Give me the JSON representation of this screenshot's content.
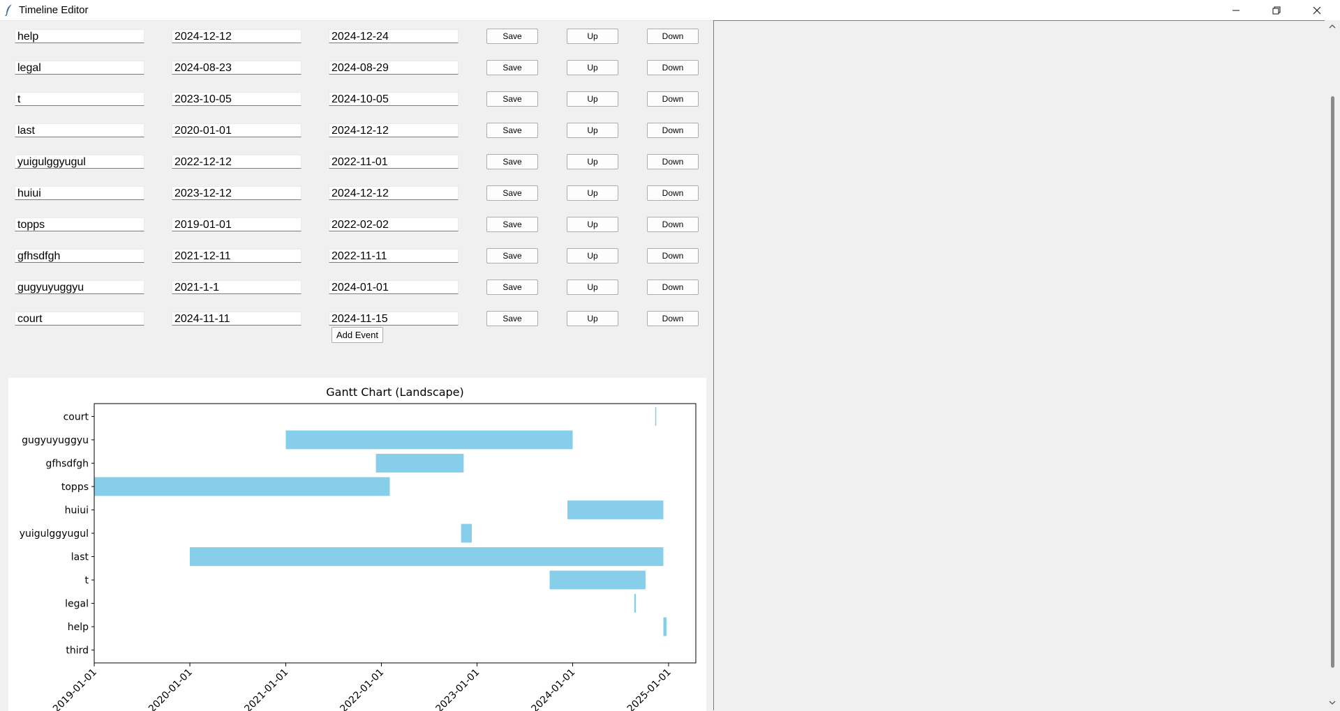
{
  "window": {
    "title": "Timeline Editor"
  },
  "events": [
    {
      "name": "help",
      "start": "2024-12-12",
      "end": "2024-12-24"
    },
    {
      "name": "legal",
      "start": "2024-08-23",
      "end": "2024-08-29"
    },
    {
      "name": "t",
      "start": "2023-10-05",
      "end": "2024-10-05"
    },
    {
      "name": "last",
      "start": "2020-01-01",
      "end": "2024-12-12"
    },
    {
      "name": "yuigulggyugul",
      "start": "2022-12-12",
      "end": "2022-11-01"
    },
    {
      "name": "huiui",
      "start": "2023-12-12",
      "end": "2024-12-12"
    },
    {
      "name": "topps",
      "start": "2019-01-01",
      "end": "2022-02-02"
    },
    {
      "name": "gfhsdfgh",
      "start": "2021-12-11",
      "end": "2022-11-11"
    },
    {
      "name": "gugyuyuggyu",
      "start": "2021-1-1",
      "end": "2024-01-01"
    },
    {
      "name": "court",
      "start": "2024-11-11",
      "end": "2024-11-15"
    }
  ],
  "row_buttons": {
    "save": "Save",
    "up": "Up",
    "down": "Down"
  },
  "add_button": "Add Event",
  "colors": {
    "bar": "#87ceeb",
    "window_bg": "#f0f0f0"
  },
  "chart_data": {
    "type": "bar",
    "orientation": "horizontal",
    "title": "Gantt Chart (Landscape)",
    "xlabel": "",
    "ylabel": "",
    "categories": [
      "third",
      "help",
      "legal",
      "t",
      "last",
      "yuigulggyugul",
      "huiui",
      "topps",
      "gfhsdfgh",
      "gugyuyuggyu",
      "court"
    ],
    "series": [
      {
        "values": [
          null,
          [
            "2024-12-12",
            "2024-12-24"
          ],
          [
            "2024-08-23",
            "2024-08-29"
          ],
          [
            "2023-10-05",
            "2024-10-05"
          ],
          [
            "2020-01-01",
            "2024-12-12"
          ],
          [
            "2022-11-01",
            "2022-12-12"
          ],
          [
            "2023-12-12",
            "2024-12-12"
          ],
          [
            "2019-01-01",
            "2022-02-02"
          ],
          [
            "2021-12-11",
            "2022-11-11"
          ],
          [
            "2021-01-01",
            "2024-01-01"
          ],
          [
            "2024-11-11",
            "2024-11-15"
          ]
        ]
      }
    ],
    "x_ticks": [
      "2019-01-01",
      "2020-01-01",
      "2021-01-01",
      "2022-01-01",
      "2023-01-01",
      "2024-01-01",
      "2025-01-01"
    ],
    "xlim": [
      "2019-01-01",
      "2025-04-15"
    ],
    "grid": false,
    "legend": "none"
  }
}
